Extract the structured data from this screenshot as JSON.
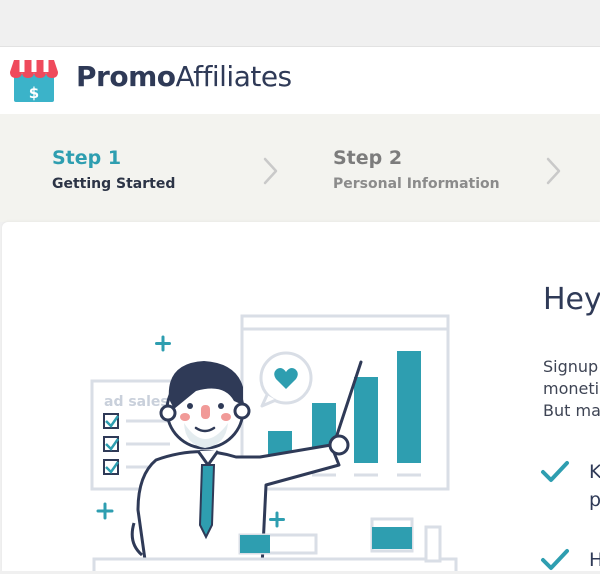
{
  "header": {
    "brand_bold": "Promo",
    "brand_light": "Affiliates",
    "logo_icon": "storefront-dollar-icon",
    "logo_symbol": "$"
  },
  "steps": [
    {
      "number": "Step 1",
      "label": "Getting Started",
      "state": "active"
    },
    {
      "number": "Step 2",
      "label": "Personal Information",
      "state": "inactive"
    }
  ],
  "illustration": {
    "board_text": "ad sales",
    "icons": [
      "heart-bubble-icon",
      "checklist-icon",
      "bar-chart-icon",
      "plus-icon"
    ]
  },
  "content": {
    "heading": "Hey",
    "paragraph": "Signup\nmoneti\nBut ma",
    "checklist": [
      {
        "text": "K\np"
      },
      {
        "text": "H"
      }
    ]
  },
  "colors": {
    "accent": "#2e9eb0",
    "dark_text": "#2f3a57",
    "logo_red": "#ef4a5c",
    "step_bar": "#f3f3ef"
  }
}
